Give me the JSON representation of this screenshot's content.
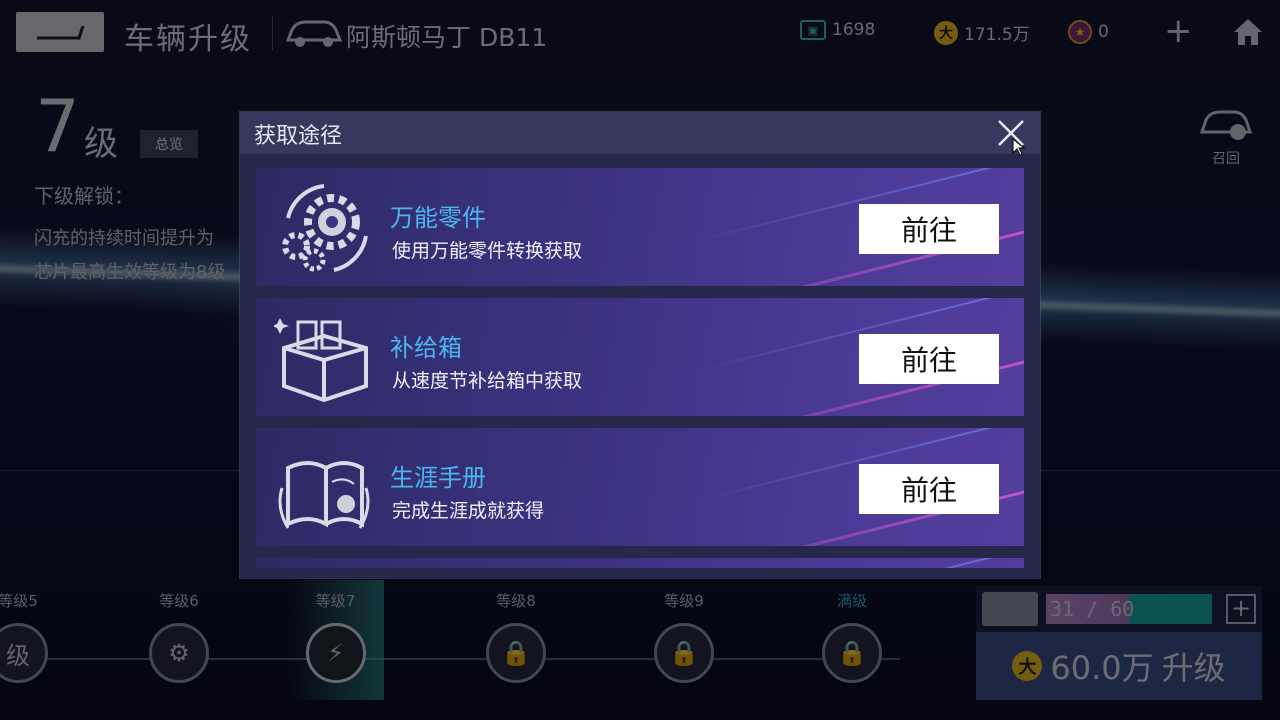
{
  "header": {
    "title": "车辆升级",
    "car_name": "阿斯顿马丁 DB11",
    "currencies": {
      "tickets": "1698",
      "gold": "171.5万",
      "medals": "0"
    },
    "coin_glyph": "大"
  },
  "left_panel": {
    "level": "7",
    "level_unit": "级",
    "overview_label": "总览",
    "next_unlock_title": "下级解锁：",
    "desc_line1": "闪充的持续时间提升为",
    "desc_line2": "芯片最高生效等级为8级",
    "recall_label": "召回"
  },
  "modal": {
    "title": "获取途径",
    "sources": [
      {
        "title": "万能零件",
        "desc": "使用万能零件转换获取",
        "button": "前往",
        "icon": "gears-icon"
      },
      {
        "title": "补给箱",
        "desc": "从速度节补给箱中获取",
        "button": "前往",
        "icon": "supply-box-icon"
      },
      {
        "title": "生涯手册",
        "desc": "完成生涯成就获得",
        "button": "前往",
        "icon": "career-book-icon"
      }
    ]
  },
  "levels": [
    {
      "label": "等级5",
      "icon": "partial-node-icon",
      "glyph": "级"
    },
    {
      "label": "等级6",
      "icon": "bolts-icon",
      "glyph": "⚙"
    },
    {
      "label": "等级7",
      "icon": "lightning-icon",
      "glyph": "⚡"
    },
    {
      "label": "等级8",
      "icon": "lock-icon",
      "glyph": "🔒"
    },
    {
      "label": "等级9",
      "icon": "lock-icon",
      "glyph": "🔒"
    },
    {
      "label": "满级",
      "icon": "lock-icon",
      "glyph": "🔒"
    }
  ],
  "upgrade": {
    "progress_text": "31 / 60",
    "progress_fraction": 0.517,
    "plus_label": "+",
    "cost": "60.0万",
    "action": "升级"
  },
  "colors": {
    "accent_blue": "#4ab8f0",
    "teal": "#1aa6a6",
    "gold": "#e8b820"
  }
}
